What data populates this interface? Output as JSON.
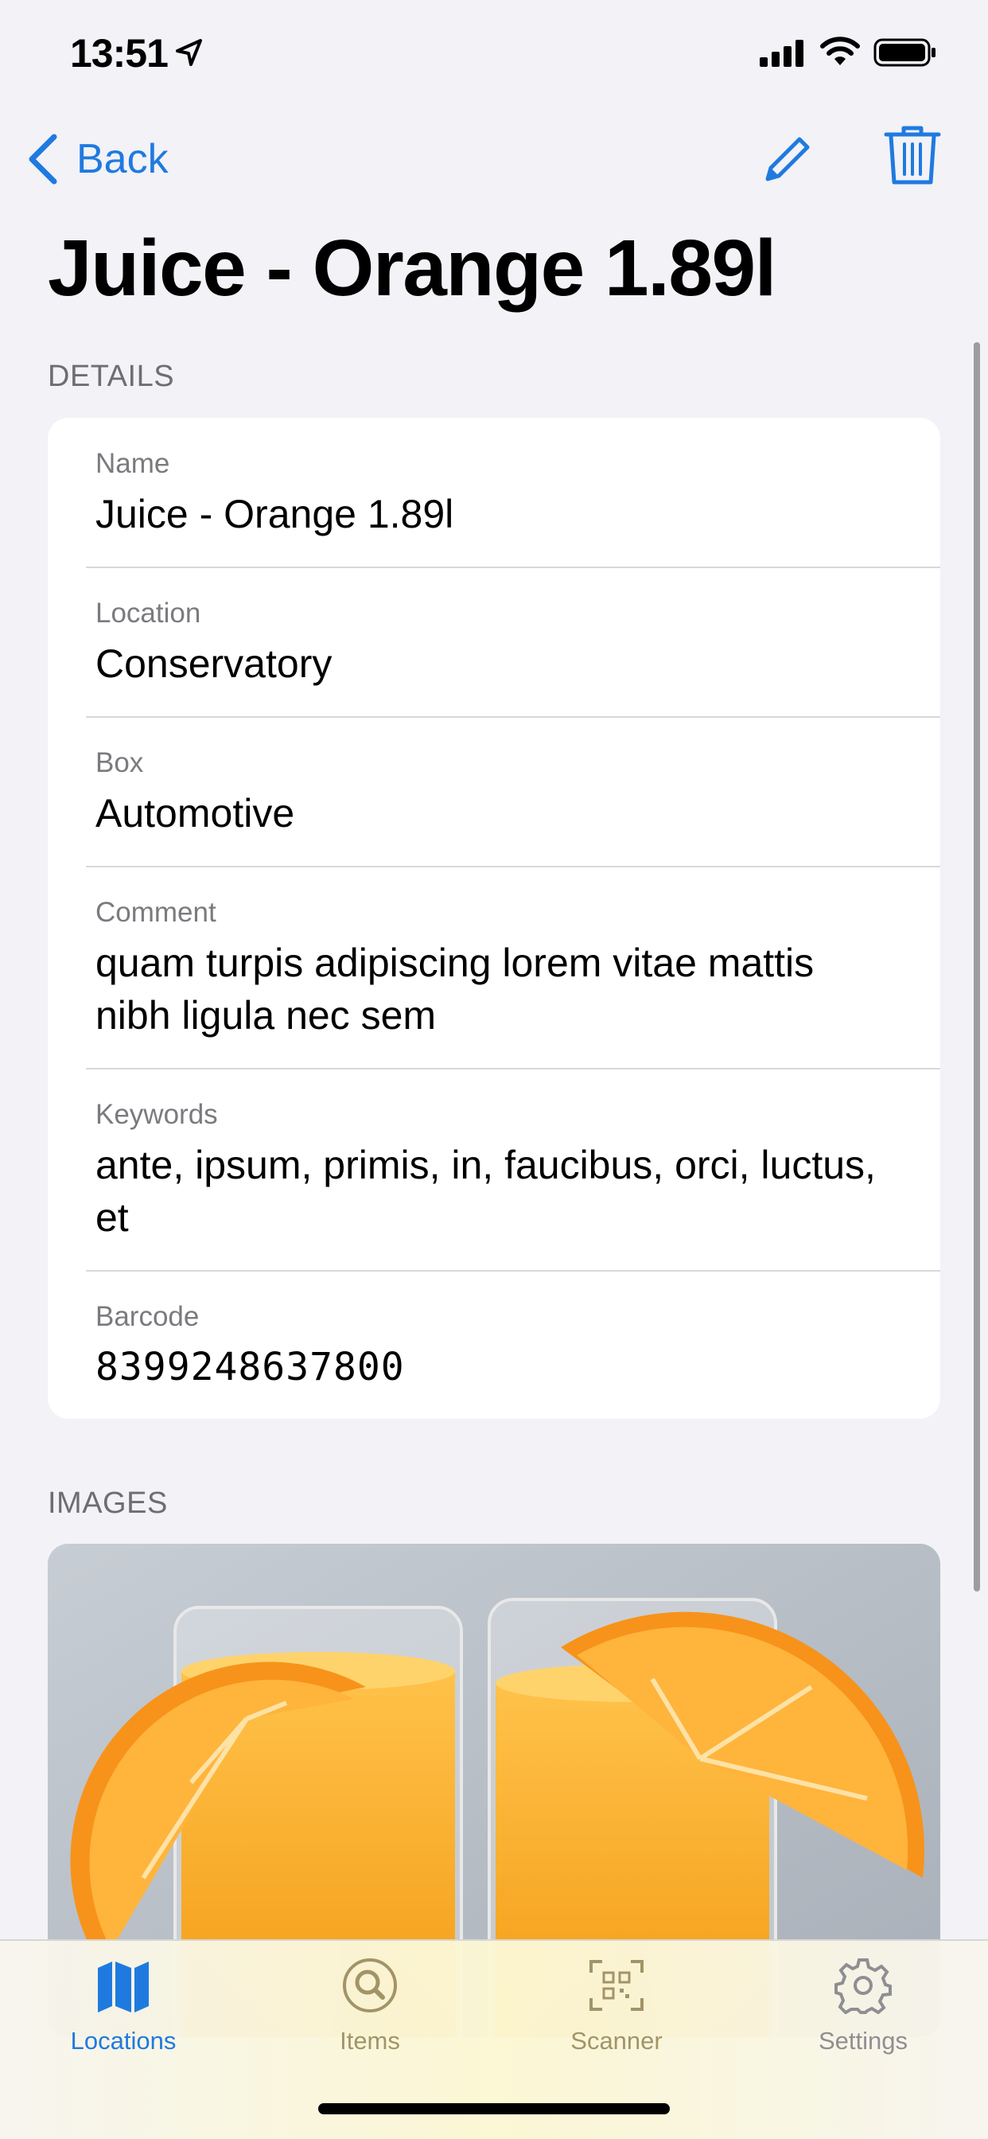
{
  "status_bar": {
    "time": "13:51",
    "icons": [
      "location-arrow-icon",
      "cellular-signal-icon",
      "wifi-icon",
      "battery-icon"
    ]
  },
  "nav": {
    "back_label": "Back",
    "edit_icon": "pencil-icon",
    "delete_icon": "trash-icon"
  },
  "page": {
    "title": "Juice - Orange 1.89l"
  },
  "details": {
    "header": "DETAILS",
    "fields": [
      {
        "label": "Name",
        "value": "Juice - Orange 1.89l"
      },
      {
        "label": "Location",
        "value": "Conservatory"
      },
      {
        "label": "Box",
        "value": "Automotive"
      },
      {
        "label": "Comment",
        "value": "quam turpis adipiscing lorem vitae mattis nibh ligula nec sem"
      },
      {
        "label": "Keywords",
        "value": "ante, ipsum, primis, in, faucibus, orci, luctus, et"
      },
      {
        "label": "Barcode",
        "value": "8399248637800"
      }
    ]
  },
  "images": {
    "header": "IMAGES",
    "photo_subject": "two glasses of orange juice with orange slices"
  },
  "tabbar": {
    "tabs": [
      {
        "label": "Locations",
        "icon": "map-icon",
        "active": true
      },
      {
        "label": "Items",
        "icon": "magnifier-icon",
        "active": false
      },
      {
        "label": "Scanner",
        "icon": "qr-scanner-icon",
        "active": false
      },
      {
        "label": "Settings",
        "icon": "gear-icon",
        "active": false
      }
    ]
  },
  "colors": {
    "accent": "#1f7ae0",
    "background": "#f2f2f7",
    "card": "#ffffff",
    "secondary_text": "#6d6d72"
  }
}
